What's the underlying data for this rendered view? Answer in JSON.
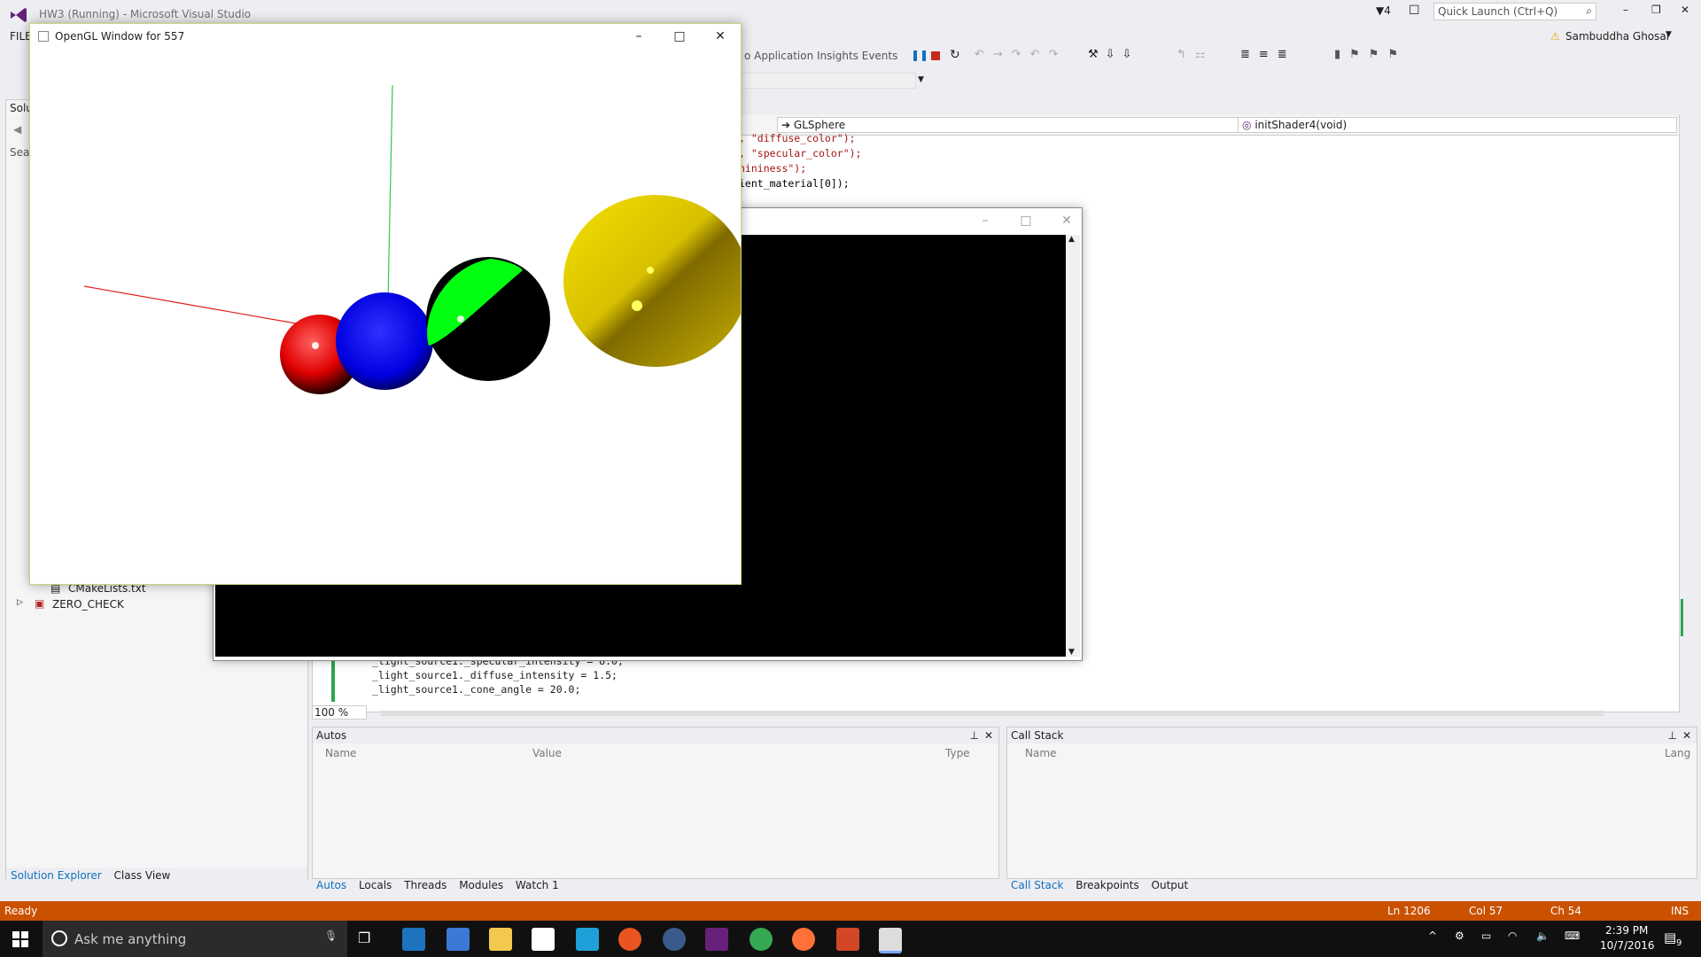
{
  "vs": {
    "title": "HW3 (Running) - Microsoft Visual Studio",
    "notification_count": "4",
    "quick_launch_placeholder": "Quick Launch (Ctrl+Q)",
    "user_name": "Sambuddha Ghosal",
    "menu_file": "FILE",
    "toolbar_text": "o Application Insights Events",
    "nav_class": "GLSphere",
    "nav_member": "initShader4(void)"
  },
  "solution_explorer": {
    "title_cut": "Solu",
    "search_cut": "Sear",
    "items": [
      "CMakeLists.txt",
      "ZERO_CHECK"
    ],
    "tabs": [
      "Solution Explorer",
      "Class View"
    ]
  },
  "editor": {
    "top_lines": [
      ", \"diffuse_color\");",
      ", \"specular_color\");",
      "hininess\");",
      "",
      "ient_material[0]);"
    ],
    "bottom_lines": [
      "_light_source1._specular_intensity = 8.0;",
      "_light_source1._diffuse_intensity = 1.5;",
      "",
      "_light_source1._cone_angle = 20.0;"
    ],
    "zoom": "100 %"
  },
  "autos": {
    "title": "Autos",
    "columns": [
      "Name",
      "Value",
      "Type"
    ],
    "tabs": [
      "Autos",
      "Locals",
      "Threads",
      "Modules",
      "Watch 1"
    ]
  },
  "callstack": {
    "title": "Call Stack",
    "columns": [
      "Name",
      "Lang"
    ],
    "tabs": [
      "Call Stack",
      "Breakpoints",
      "Output"
    ]
  },
  "status": {
    "ready": "Ready",
    "ln": "Ln 1206",
    "col": "Col 57",
    "ch": "Ch 54",
    "ins": "INS"
  },
  "gl_window": {
    "title": "OpenGL Window for 557"
  },
  "taskbar": {
    "search_placeholder": "Ask me anything",
    "time": "2:39 PM",
    "date": "10/7/2016",
    "notifications": "9"
  },
  "colors": {
    "status_bar": "#ca5100",
    "accent": "#0e70c0",
    "taskbar": "#101010"
  }
}
